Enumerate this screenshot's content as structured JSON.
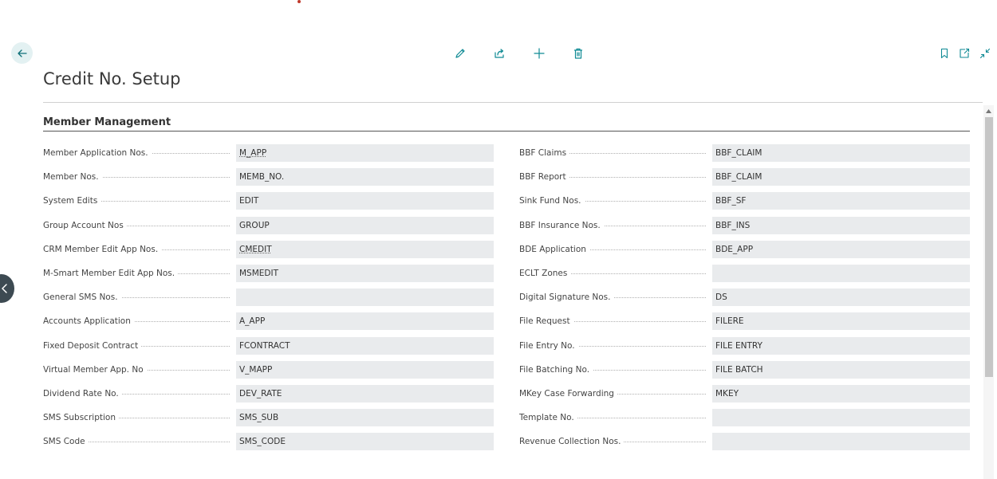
{
  "page": {
    "title": "Credit No. Setup"
  },
  "toolbar": {
    "back_icon": "arrow-left-icon",
    "edit_icon": "pencil-icon",
    "share_icon": "share-icon",
    "new_icon": "plus-icon",
    "delete_icon": "trash-icon",
    "bookmark_icon": "bookmark-icon",
    "open_new_icon": "open-new-window-icon",
    "collapse_icon": "collapse-icon"
  },
  "section": {
    "title": "Member Management"
  },
  "left_fields": [
    {
      "label": "Member Application Nos.",
      "value": "M_APP",
      "underlined": true
    },
    {
      "label": "Member Nos.",
      "value": "MEMB_NO."
    },
    {
      "label": "System Edits",
      "value": "EDIT"
    },
    {
      "label": "Group Account Nos",
      "value": "GROUP"
    },
    {
      "label": "CRM Member Edit App Nos.",
      "value": "CMEDIT",
      "underlined": true
    },
    {
      "label": "M-Smart Member Edit App Nos.",
      "value": "MSMEDIT"
    },
    {
      "label": "General SMS Nos.",
      "value": ""
    },
    {
      "label": "Accounts Application",
      "value": "A_APP"
    },
    {
      "label": "Fixed Deposit Contract",
      "value": "FCONTRACT"
    },
    {
      "label": "Virtual Member App. No",
      "value": "V_MAPP"
    },
    {
      "label": "Dividend Rate No.",
      "value": "DEV_RATE"
    },
    {
      "label": "SMS Subscription",
      "value": "SMS_SUB"
    },
    {
      "label": "SMS Code",
      "value": "SMS_CODE"
    }
  ],
  "right_fields": [
    {
      "label": "BBF Claims",
      "value": "BBF_CLAIM"
    },
    {
      "label": "BBF Report",
      "value": "BBF_CLAIM"
    },
    {
      "label": "Sink Fund Nos.",
      "value": "BBF_SF"
    },
    {
      "label": "BBF Insurance Nos.",
      "value": "BBF_INS"
    },
    {
      "label": "BDE Application",
      "value": "BDE_APP"
    },
    {
      "label": "ECLT Zones",
      "value": ""
    },
    {
      "label": "Digital Signature Nos.",
      "value": "DS"
    },
    {
      "label": "File Request",
      "value": "FILERE"
    },
    {
      "label": "File Entry No.",
      "value": "FILE ENTRY"
    },
    {
      "label": "File Batching No.",
      "value": "FILE BATCH"
    },
    {
      "label": "MKey Case Forwarding",
      "value": "MKEY"
    },
    {
      "label": "Template No.",
      "value": ""
    },
    {
      "label": "Revenue Collection Nos.",
      "value": ""
    }
  ],
  "colors": {
    "accent": "#0f8a94",
    "field_bg": "#e9ebed",
    "side_handle": "#3d4a52"
  }
}
